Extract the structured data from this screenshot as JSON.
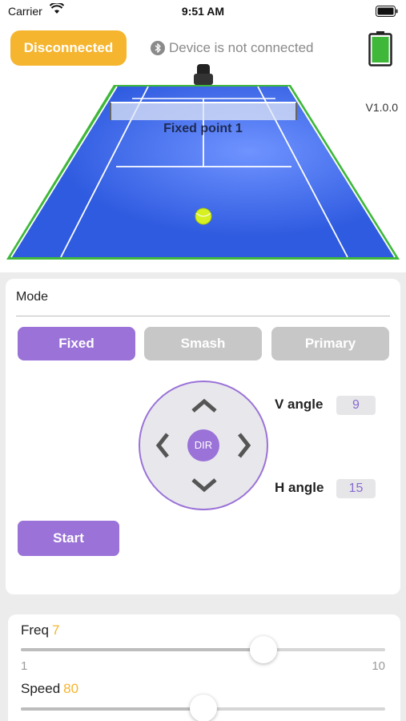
{
  "status_bar": {
    "carrier": "Carrier",
    "time": "9:51 AM"
  },
  "header": {
    "connection_button": "Disconnected",
    "device_status": "Device is not connected",
    "version": "V1.0.0",
    "court_label": "Fixed point 1",
    "battery_color": "#3fb83a"
  },
  "mode_card": {
    "title": "Mode",
    "modes": [
      {
        "label": "Fixed",
        "active": true
      },
      {
        "label": "Smash",
        "active": false
      },
      {
        "label": "Primary",
        "active": false
      }
    ],
    "dpad_center": "DIR",
    "v_angle": {
      "label": "V angle",
      "value": "9"
    },
    "h_angle": {
      "label": "H angle",
      "value": "15"
    },
    "start_button": "Start"
  },
  "sliders": {
    "freq": {
      "label": "Freq",
      "value": "7",
      "min": "1",
      "max": "10",
      "level": 0.667
    },
    "speed": {
      "label": "Speed",
      "value": "80",
      "level": 0.5
    }
  },
  "colors": {
    "accent": "#9a72d8",
    "warning": "#f5b52e",
    "court": "#2f5be0",
    "court_border": "#3fb83a"
  }
}
